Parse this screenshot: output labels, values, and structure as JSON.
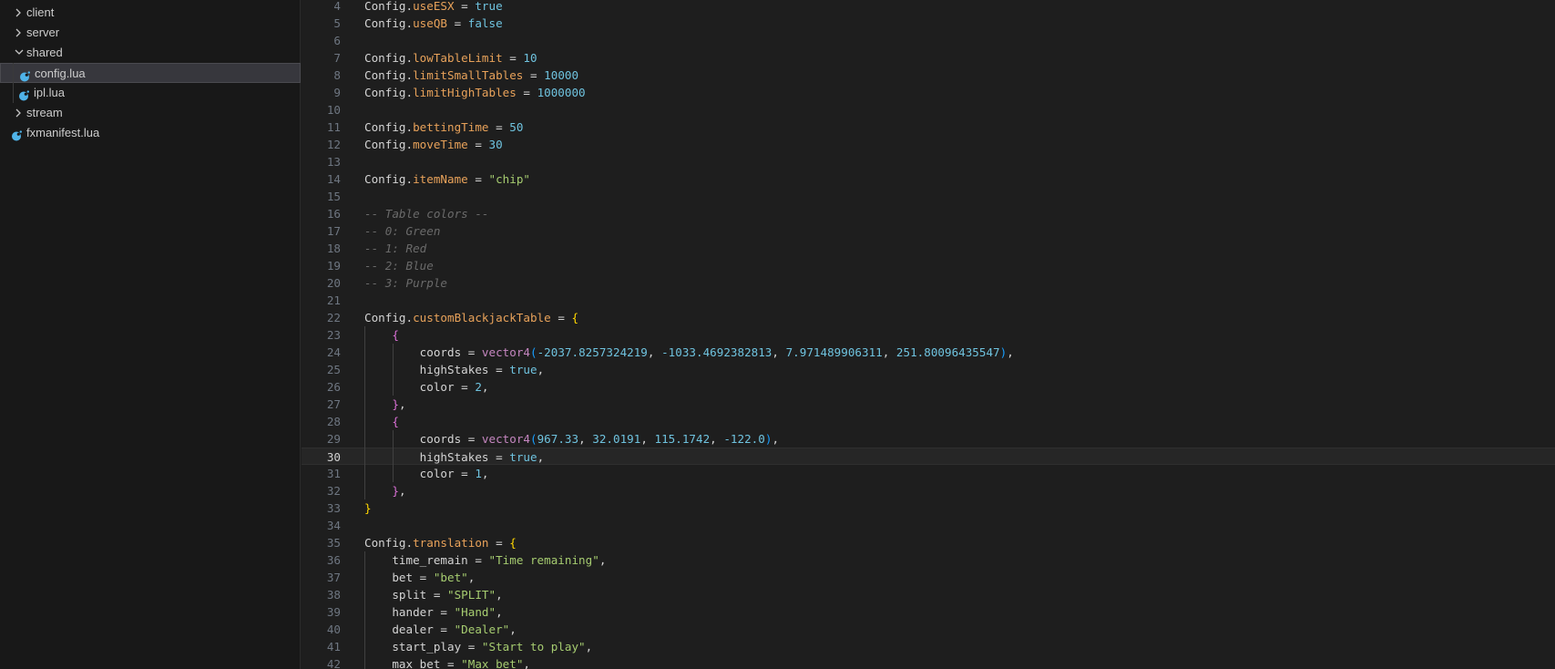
{
  "colors": {
    "sidebar_bg": "#181818",
    "editor_bg": "#1e1e1e",
    "selected_row": "#37373d",
    "lua_icon": "#4fb3e8",
    "property": "#e8a25a",
    "number": "#6fc3df",
    "string": "#a6cc70",
    "comment": "#6a6a6a",
    "function": "#c586c0"
  },
  "explorer": {
    "items": [
      {
        "label": "client",
        "type": "folder",
        "expanded": false,
        "depth": 0,
        "icon": "chevron-right-icon"
      },
      {
        "label": "server",
        "type": "folder",
        "expanded": false,
        "depth": 0,
        "icon": "chevron-right-icon"
      },
      {
        "label": "shared",
        "type": "folder",
        "expanded": true,
        "depth": 0,
        "icon": "chevron-down-icon"
      },
      {
        "label": "config.lua",
        "type": "file",
        "depth": 1,
        "icon": "lua-file-icon",
        "selected": true
      },
      {
        "label": "ipl.lua",
        "type": "file",
        "depth": 1,
        "icon": "lua-file-icon"
      },
      {
        "label": "stream",
        "type": "folder",
        "expanded": false,
        "depth": 0,
        "icon": "chevron-right-icon"
      },
      {
        "label": "fxmanifest.lua",
        "type": "file",
        "depth": 0,
        "icon": "lua-file-icon"
      }
    ]
  },
  "editor": {
    "current_line": 30,
    "lines": [
      {
        "n": 4,
        "tokens": [
          [
            "t-plain",
            "Config."
          ],
          [
            "t-prop",
            "useESX"
          ],
          [
            "t-op",
            " = "
          ],
          [
            "t-bool",
            "true"
          ]
        ]
      },
      {
        "n": 5,
        "tokens": [
          [
            "t-plain",
            "Config."
          ],
          [
            "t-prop",
            "useQB"
          ],
          [
            "t-op",
            " = "
          ],
          [
            "t-bool",
            "false"
          ]
        ]
      },
      {
        "n": 6,
        "tokens": []
      },
      {
        "n": 7,
        "tokens": [
          [
            "t-plain",
            "Config."
          ],
          [
            "t-prop",
            "lowTableLimit"
          ],
          [
            "t-op",
            " = "
          ],
          [
            "t-num",
            "10"
          ]
        ]
      },
      {
        "n": 8,
        "tokens": [
          [
            "t-plain",
            "Config."
          ],
          [
            "t-prop",
            "limitSmallTables"
          ],
          [
            "t-op",
            " = "
          ],
          [
            "t-num",
            "10000"
          ]
        ]
      },
      {
        "n": 9,
        "tokens": [
          [
            "t-plain",
            "Config."
          ],
          [
            "t-prop",
            "limitHighTables"
          ],
          [
            "t-op",
            " = "
          ],
          [
            "t-num",
            "1000000"
          ]
        ]
      },
      {
        "n": 10,
        "tokens": []
      },
      {
        "n": 11,
        "tokens": [
          [
            "t-plain",
            "Config."
          ],
          [
            "t-prop",
            "bettingTime"
          ],
          [
            "t-op",
            " = "
          ],
          [
            "t-num",
            "50"
          ]
        ]
      },
      {
        "n": 12,
        "tokens": [
          [
            "t-plain",
            "Config."
          ],
          [
            "t-prop",
            "moveTime"
          ],
          [
            "t-op",
            " = "
          ],
          [
            "t-num",
            "30"
          ]
        ]
      },
      {
        "n": 13,
        "tokens": []
      },
      {
        "n": 14,
        "tokens": [
          [
            "t-plain",
            "Config."
          ],
          [
            "t-prop",
            "itemName"
          ],
          [
            "t-op",
            " = "
          ],
          [
            "t-str",
            "\"chip\""
          ]
        ]
      },
      {
        "n": 15,
        "tokens": []
      },
      {
        "n": 16,
        "tokens": [
          [
            "t-cmt",
            "-- Table colors --"
          ]
        ]
      },
      {
        "n": 17,
        "tokens": [
          [
            "t-cmt",
            "-- 0: Green"
          ]
        ]
      },
      {
        "n": 18,
        "tokens": [
          [
            "t-cmt",
            "-- 1: Red"
          ]
        ]
      },
      {
        "n": 19,
        "tokens": [
          [
            "t-cmt",
            "-- 2: Blue"
          ]
        ]
      },
      {
        "n": 20,
        "tokens": [
          [
            "t-cmt",
            "-- 3: Purple"
          ]
        ]
      },
      {
        "n": 21,
        "tokens": []
      },
      {
        "n": 22,
        "tokens": [
          [
            "t-plain",
            "Config."
          ],
          [
            "t-prop",
            "customBlackjackTable"
          ],
          [
            "t-op",
            " = "
          ],
          [
            "t-b1",
            "{"
          ]
        ]
      },
      {
        "n": 23,
        "tokens": [
          [
            "t-plain",
            "    "
          ],
          [
            "t-b2",
            "{"
          ]
        ]
      },
      {
        "n": 24,
        "tokens": [
          [
            "t-plain",
            "        coords"
          ],
          [
            "t-op",
            " = "
          ],
          [
            "t-fn",
            "vector4"
          ],
          [
            "t-b3",
            "("
          ],
          [
            "t-num",
            "-2037.8257324219"
          ],
          [
            "t-plain",
            ", "
          ],
          [
            "t-num",
            "-1033.4692382813"
          ],
          [
            "t-plain",
            ", "
          ],
          [
            "t-num",
            "7.971489906311"
          ],
          [
            "t-plain",
            ", "
          ],
          [
            "t-num",
            "251.80096435547"
          ],
          [
            "t-b3",
            ")"
          ],
          [
            "t-plain",
            ","
          ]
        ]
      },
      {
        "n": 25,
        "tokens": [
          [
            "t-plain",
            "        highStakes"
          ],
          [
            "t-op",
            " = "
          ],
          [
            "t-bool",
            "true"
          ],
          [
            "t-plain",
            ","
          ]
        ]
      },
      {
        "n": 26,
        "tokens": [
          [
            "t-plain",
            "        color"
          ],
          [
            "t-op",
            " = "
          ],
          [
            "t-num",
            "2"
          ],
          [
            "t-plain",
            ","
          ]
        ]
      },
      {
        "n": 27,
        "tokens": [
          [
            "t-plain",
            "    "
          ],
          [
            "t-b2",
            "}"
          ],
          [
            "t-plain",
            ","
          ]
        ]
      },
      {
        "n": 28,
        "tokens": [
          [
            "t-plain",
            "    "
          ],
          [
            "t-b2",
            "{"
          ]
        ]
      },
      {
        "n": 29,
        "tokens": [
          [
            "t-plain",
            "        coords"
          ],
          [
            "t-op",
            " = "
          ],
          [
            "t-fn",
            "vector4"
          ],
          [
            "t-b3",
            "("
          ],
          [
            "t-num",
            "967.33"
          ],
          [
            "t-plain",
            ", "
          ],
          [
            "t-num",
            "32.0191"
          ],
          [
            "t-plain",
            ", "
          ],
          [
            "t-num",
            "115.1742"
          ],
          [
            "t-plain",
            ", "
          ],
          [
            "t-num",
            "-122.0"
          ],
          [
            "t-b3",
            ")"
          ],
          [
            "t-plain",
            ","
          ]
        ]
      },
      {
        "n": 30,
        "tokens": [
          [
            "t-plain",
            "        highStakes"
          ],
          [
            "t-op",
            " = "
          ],
          [
            "t-bool",
            "true"
          ],
          [
            "t-plain",
            ","
          ]
        ]
      },
      {
        "n": 31,
        "tokens": [
          [
            "t-plain",
            "        color"
          ],
          [
            "t-op",
            " = "
          ],
          [
            "t-num",
            "1"
          ],
          [
            "t-plain",
            ","
          ]
        ]
      },
      {
        "n": 32,
        "tokens": [
          [
            "t-plain",
            "    "
          ],
          [
            "t-b2",
            "}"
          ],
          [
            "t-plain",
            ","
          ]
        ]
      },
      {
        "n": 33,
        "tokens": [
          [
            "t-b1",
            "}"
          ]
        ]
      },
      {
        "n": 34,
        "tokens": []
      },
      {
        "n": 35,
        "tokens": [
          [
            "t-plain",
            "Config."
          ],
          [
            "t-prop",
            "translation"
          ],
          [
            "t-op",
            " = "
          ],
          [
            "t-b1",
            "{"
          ]
        ]
      },
      {
        "n": 36,
        "tokens": [
          [
            "t-plain",
            "    time_remain"
          ],
          [
            "t-op",
            " = "
          ],
          [
            "t-str",
            "\"Time remaining\""
          ],
          [
            "t-plain",
            ","
          ]
        ]
      },
      {
        "n": 37,
        "tokens": [
          [
            "t-plain",
            "    bet"
          ],
          [
            "t-op",
            " = "
          ],
          [
            "t-str",
            "\"bet\""
          ],
          [
            "t-plain",
            ","
          ]
        ]
      },
      {
        "n": 38,
        "tokens": [
          [
            "t-plain",
            "    split"
          ],
          [
            "t-op",
            " = "
          ],
          [
            "t-str",
            "\"SPLIT\""
          ],
          [
            "t-plain",
            ","
          ]
        ]
      },
      {
        "n": 39,
        "tokens": [
          [
            "t-plain",
            "    hander"
          ],
          [
            "t-op",
            " = "
          ],
          [
            "t-str",
            "\"Hand\""
          ],
          [
            "t-plain",
            ","
          ]
        ]
      },
      {
        "n": 40,
        "tokens": [
          [
            "t-plain",
            "    dealer"
          ],
          [
            "t-op",
            " = "
          ],
          [
            "t-str",
            "\"Dealer\""
          ],
          [
            "t-plain",
            ","
          ]
        ]
      },
      {
        "n": 41,
        "tokens": [
          [
            "t-plain",
            "    start_play"
          ],
          [
            "t-op",
            " = "
          ],
          [
            "t-str",
            "\"Start to play\""
          ],
          [
            "t-plain",
            ","
          ]
        ]
      },
      {
        "n": 42,
        "tokens": [
          [
            "t-plain",
            "    max_bet"
          ],
          [
            "t-op",
            " = "
          ],
          [
            "t-str",
            "\"Max bet\""
          ],
          [
            "t-plain",
            ","
          ]
        ]
      }
    ]
  }
}
